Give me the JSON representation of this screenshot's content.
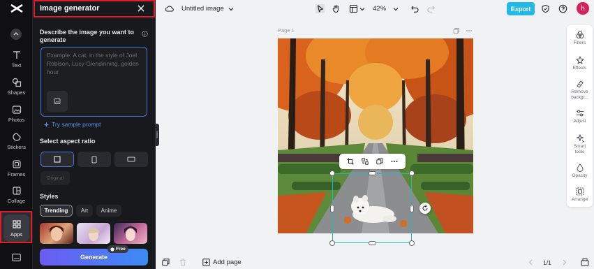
{
  "rail": {
    "items": [
      {
        "label": "Text"
      },
      {
        "label": "Shapes"
      },
      {
        "label": "Photos"
      },
      {
        "label": "Stickers"
      },
      {
        "label": "Frames"
      },
      {
        "label": "Collage"
      },
      {
        "label": "Apps"
      }
    ]
  },
  "panel": {
    "title": "Image generator",
    "describe_label": "Describe the image you want to generate",
    "prompt_placeholder": "Example: A cat, in the style of Joel Robison, Lucy Glendinning, golden hour",
    "sample_link": "Try sample prompt",
    "aspect_label": "Select aspect ratio",
    "original_label": "Original",
    "styles_label": "Styles",
    "style_tabs": [
      "Trending",
      "Art",
      "Anime"
    ],
    "generate_label": "Generate",
    "free_badge": "Free"
  },
  "topbar": {
    "doc_title": "Untitled image",
    "zoom": "42%",
    "export_label": "Export",
    "avatar_initial": "h"
  },
  "canvas": {
    "page_label": "Page 1"
  },
  "right_tools": [
    {
      "label": "Filters"
    },
    {
      "label": "Effects"
    },
    {
      "label": "Remove backgr..."
    },
    {
      "label": "Adjust"
    },
    {
      "label": "Smart tools"
    },
    {
      "label": "Opacity"
    },
    {
      "label": "Arrange"
    }
  ],
  "bottombar": {
    "add_page_label": "Add page",
    "page_counter": "1/1"
  },
  "colors": {
    "accent": "#21b8ea",
    "selection": "#23b6c8",
    "highlight": "#e21c2a",
    "panel_bg": "#18191c"
  }
}
